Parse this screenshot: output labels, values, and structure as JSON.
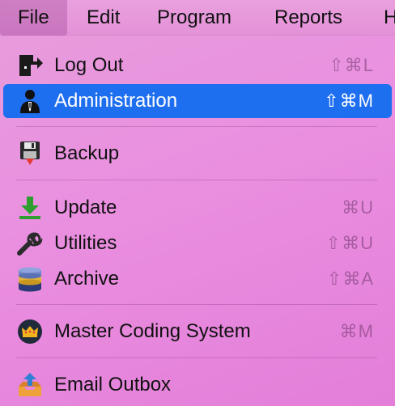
{
  "menubar": {
    "items": [
      {
        "label": "File"
      },
      {
        "label": "Edit"
      },
      {
        "label": "Program"
      },
      {
        "label": "Reports"
      },
      {
        "label": "H"
      }
    ]
  },
  "menu": {
    "items": [
      {
        "label": "Log Out",
        "shortcut": "⇧⌘L",
        "icon": "logout-door-icon"
      },
      {
        "label": "Administration",
        "shortcut": "⇧⌘M",
        "icon": "admin-person-icon",
        "highlighted": true
      },
      {
        "label": "Backup",
        "shortcut": "",
        "icon": "floppy-disk-icon"
      },
      {
        "label": "Update",
        "shortcut": "⌘U",
        "icon": "download-arrow-icon"
      },
      {
        "label": "Utilities",
        "shortcut": "⇧⌘U",
        "icon": "wrench-icon"
      },
      {
        "label": "Archive",
        "shortcut": "⇧⌘A",
        "icon": "database-icon"
      },
      {
        "label": "Master Coding System",
        "shortcut": "⌘M",
        "icon": "crown-badge-icon"
      },
      {
        "label": "Email Outbox",
        "shortcut": "",
        "icon": "outbox-tray-icon"
      }
    ]
  },
  "colors": {
    "highlight": "#1e6ef0",
    "background": "#e98fe0"
  }
}
